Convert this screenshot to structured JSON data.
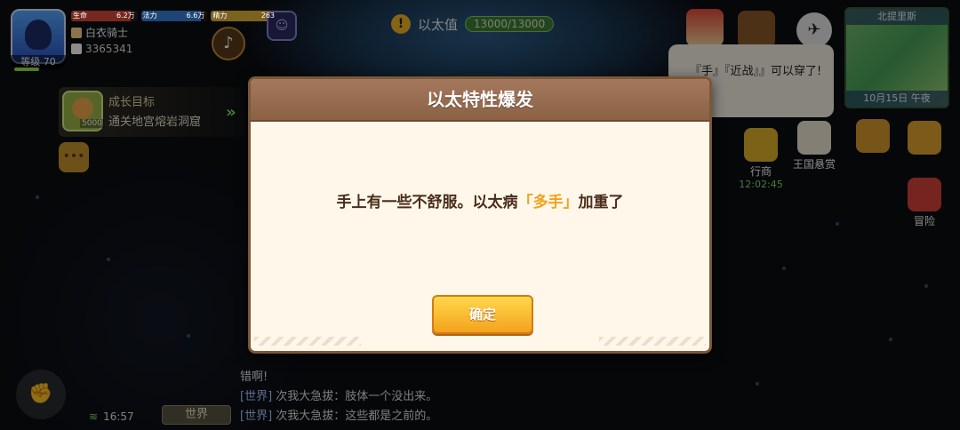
{
  "player": {
    "level_label": "等级 70",
    "hp_label": "生命",
    "hp_value": "6.2万",
    "mp_label": "法力",
    "mp_value": "6.6万",
    "stamina_label": "精力",
    "stamina_value": "263",
    "name": "白衣骑士",
    "id_number": "3365341"
  },
  "ether": {
    "label": "以太值",
    "value": "13000/13000"
  },
  "minimap": {
    "location": "北提里斯",
    "date": "10月15日 午夜"
  },
  "bubble_text": "『手』『近战』』可以穿了!",
  "menu": {
    "merchant": "行商",
    "merchant_timer": "12:02:45",
    "kingdom_bounty": "王国悬赏",
    "adventure": "冒险"
  },
  "growth": {
    "title": "成长目标",
    "goal": "通关地宫熔岩洞窟",
    "reward_count": "5000"
  },
  "bottom": {
    "time": "16:57",
    "channel_button": "世界",
    "chat_lines": [
      {
        "channel": "",
        "text": "错啊!"
      },
      {
        "channel": "[世界]",
        "text": "次我大急拔：肢体一个没出来。"
      },
      {
        "channel": "[世界]",
        "text": "次我大急拔：这些都是之前的。"
      }
    ]
  },
  "modal": {
    "title": "以太特性爆发",
    "message_prefix": "手上有一些不舒服。以太病",
    "message_highlight": "「多手」",
    "message_suffix": "加重了",
    "confirm_label": "确定"
  },
  "colors": {
    "accent_gold": "#f2a31a",
    "header_brown": "#8b6246",
    "hp_bar": "#d84a3a",
    "mp_bar": "#3a7fd8",
    "stamina_bar": "#e0b23a"
  },
  "icons": [
    "music-icon",
    "emote-icon",
    "warning-icon",
    "shop-icon",
    "scale-icon",
    "compass-icon",
    "merchant-icon",
    "bounty-icon",
    "chest-icon",
    "grid-icon",
    "adventure-icon",
    "handshake-icon",
    "wifi-icon"
  ]
}
